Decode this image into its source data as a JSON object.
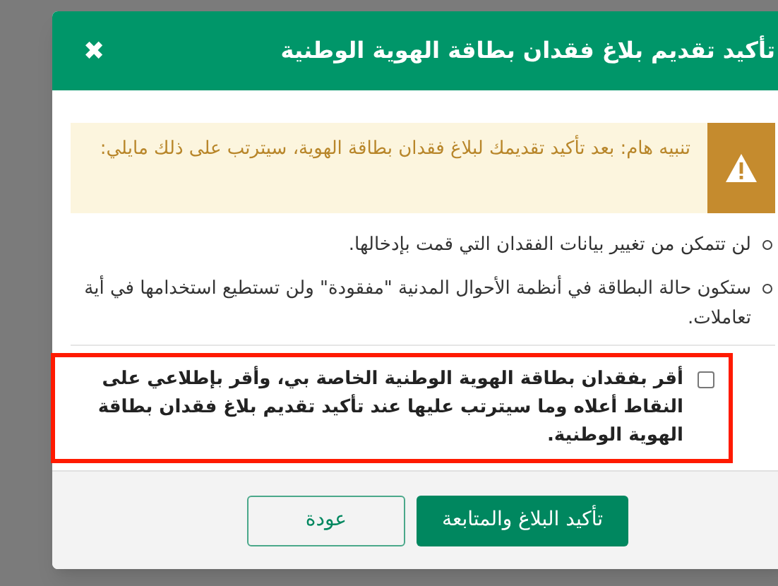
{
  "dialog": {
    "title": "تأكيد تقديم بلاغ فقدان بطاقة الهوية الوطنية",
    "close": "✖"
  },
  "alert": {
    "text": "تنبيه هام: بعد تأكيد تقديمك لبلاغ فقدان بطاقة الهوية، سيترتب على ذلك مايلي:"
  },
  "points": [
    "لن تتمكن من تغيير بيانات الفقدان التي قمت بإدخالها.",
    "ستكون حالة البطاقة في أنظمة الأحوال المدنية \"مفقودة\" ولن تستطيع استخدامها في أية تعاملات."
  ],
  "acknowledgement": {
    "text": "أقر بفقدان بطاقة الهوية الوطنية الخاصة بي، وأقر بإطلاعي على النقاط أعلاه وما سيترتب عليها عند تأكيد تقديم بلاغ فقدان بطاقة الهوية الوطنية.",
    "checked": false,
    "highlighted": true
  },
  "buttons": [
    {
      "label": "تأكيد البلاغ والمتابعة",
      "kind": "primary"
    },
    {
      "label": "عودة",
      "kind": "secondary"
    }
  ]
}
